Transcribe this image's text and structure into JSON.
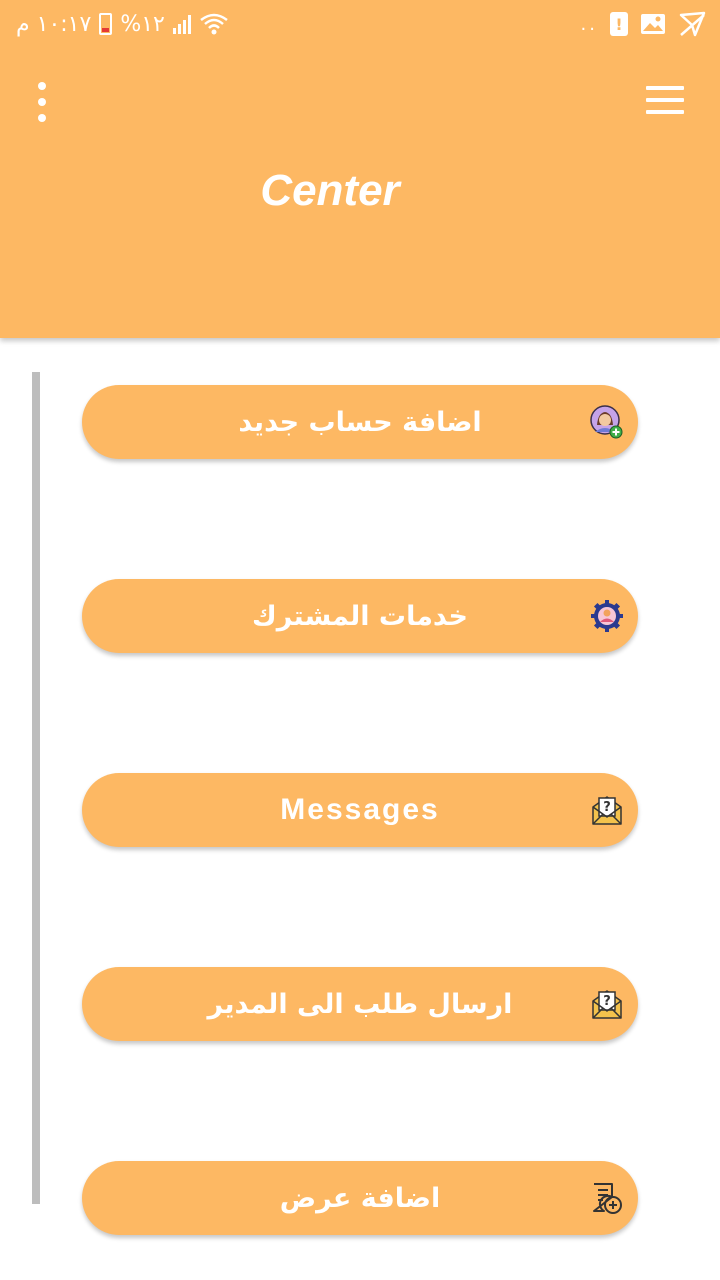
{
  "status_bar": {
    "time": "١٠:١٧ م",
    "battery": "%١٢",
    "network": "..",
    "alert": "!"
  },
  "header": {
    "title": "Center"
  },
  "menu": {
    "items": [
      {
        "label": "اضافة حساب جديد",
        "icon": "add-user-icon"
      },
      {
        "label": "خدمات المشترك",
        "icon": "subscriber-settings-icon"
      },
      {
        "label": "Messages",
        "icon": "mail-question-icon"
      },
      {
        "label": "ارسال طلب الى المدير",
        "icon": "mail-question-icon"
      },
      {
        "label": "اضافة عرض",
        "icon": "add-document-icon"
      }
    ]
  },
  "colors": {
    "primary": "#FDB863",
    "divider": "#BDBDBD",
    "text": "#FFFFFF"
  }
}
